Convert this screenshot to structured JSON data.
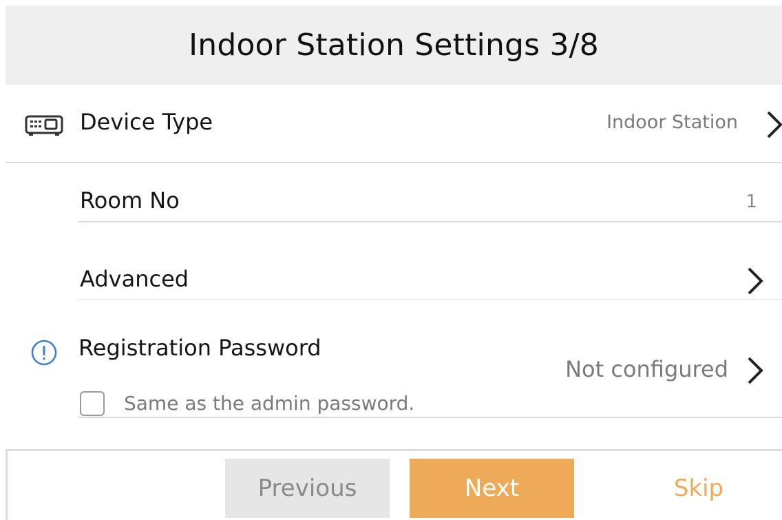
{
  "header": {
    "title": "Indoor Station Settings 3/8"
  },
  "rows": {
    "device_type": {
      "icon": "device-icon",
      "label": "Device Type",
      "value": "Indoor Station"
    },
    "room_no": {
      "label": "Room No",
      "value": "1"
    },
    "advanced": {
      "label": "Advanced"
    },
    "registration_password": {
      "icon": "info-icon",
      "label": "Registration Password",
      "value": "Not configured",
      "checkbox_label": "Same as the admin password.",
      "checkbox_checked": false
    }
  },
  "footer": {
    "previous_label": "Previous",
    "next_label": "Next",
    "skip_label": "Skip"
  },
  "colors": {
    "accent": "#edab5a",
    "info_blue": "#3b7de0",
    "header_bg": "#efefef",
    "divider": "#d9d9d9",
    "secondary_button_bg": "#e6e6e6"
  }
}
